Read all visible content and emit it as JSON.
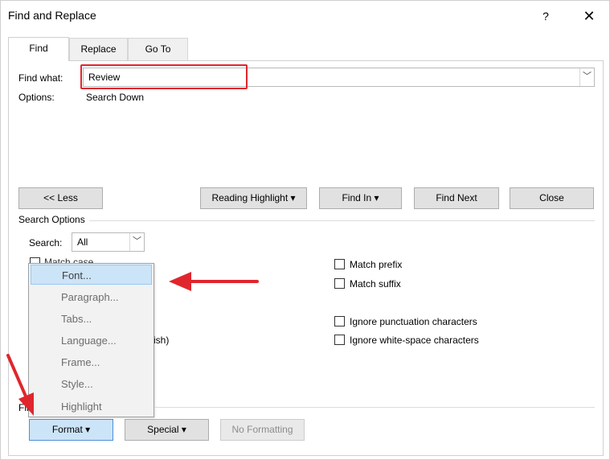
{
  "window": {
    "title": "Find and Replace",
    "help_glyph": "?",
    "close_glyph": "✕"
  },
  "tabs": [
    {
      "label": "Find",
      "active": true
    },
    {
      "label": "Replace",
      "active": false
    },
    {
      "label": "Go To",
      "active": false
    }
  ],
  "find": {
    "label": "Find what:",
    "value": "Review",
    "options_label": "Options:",
    "options_value": "Search Down"
  },
  "buttons": {
    "less": "<< Less",
    "reading_highlight": "Reading Highlight ▾",
    "find_in": "Find In ▾",
    "find_next": "Find Next",
    "close": "Close"
  },
  "search_options": {
    "title": "Search Options",
    "search_label": "Search:",
    "search_value": "All",
    "match_case_partial": "Match case",
    "partial_right_text": "ish)",
    "right_options": [
      "Match prefix",
      "Match suffix",
      "Ignore punctuation characters",
      "Ignore white-space characters"
    ]
  },
  "format_menu": {
    "items": [
      "Font...",
      "Paragraph...",
      "Tabs...",
      "Language...",
      "Frame...",
      "Style...",
      "Highlight"
    ],
    "selected_index": 0
  },
  "bottom": {
    "find_section_partial": "Fin",
    "format": "Format ▾",
    "special": "Special ▾",
    "no_formatting": "No Formatting"
  },
  "colors": {
    "annotation": "#e0262d",
    "menu_selected": "#cce4f7"
  }
}
